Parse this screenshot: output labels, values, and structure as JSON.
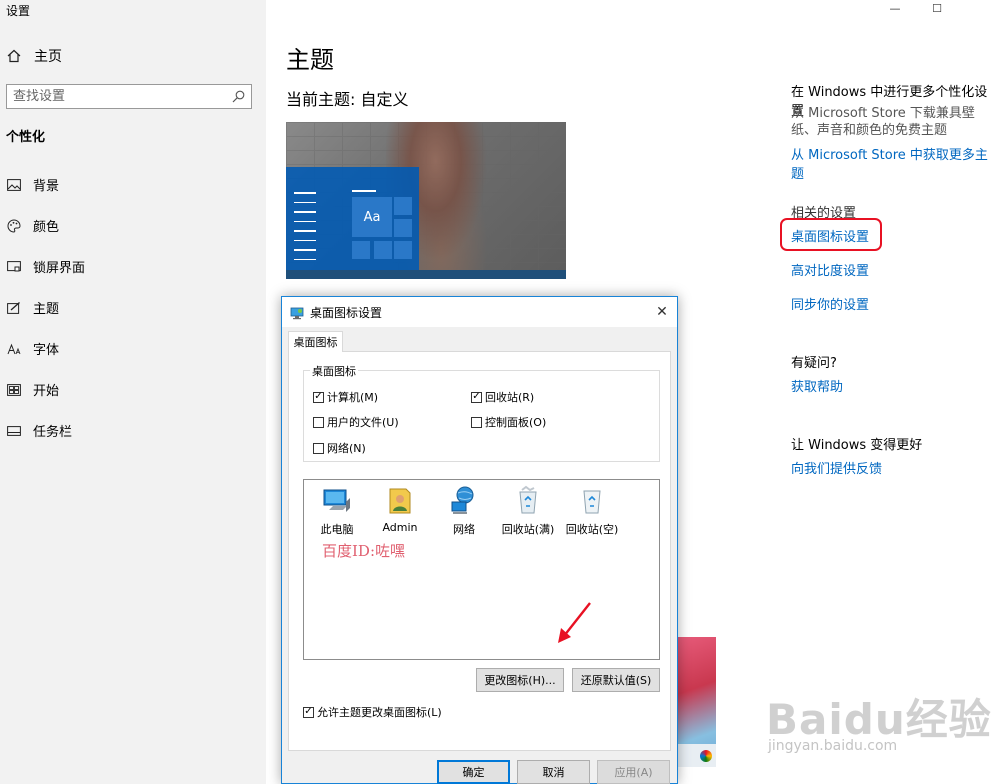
{
  "app": {
    "title": "设置"
  },
  "window_controls": {
    "minimize": "—",
    "maximize": "☐"
  },
  "sidebar": {
    "home_label": "主页",
    "search_placeholder": "查找设置",
    "section_title": "个性化",
    "items": [
      {
        "label": "背景",
        "icon": "picture-icon"
      },
      {
        "label": "颜色",
        "icon": "palette-icon"
      },
      {
        "label": "锁屏界面",
        "icon": "lock-screen-icon"
      },
      {
        "label": "主题",
        "icon": "theme-icon"
      },
      {
        "label": "字体",
        "icon": "font-icon"
      },
      {
        "label": "开始",
        "icon": "start-icon"
      },
      {
        "label": "任务栏",
        "icon": "taskbar-icon"
      }
    ]
  },
  "main": {
    "title": "主题",
    "current_theme": "当前主题: 自定义",
    "preview_sample_text": "Aa"
  },
  "right_column": {
    "more_heading": "在 Windows 中进行更多个性化设置",
    "more_desc": "从 Microsoft Store 下载兼具壁纸、声音和颜色的免费主题",
    "more_link": "从 Microsoft Store 中获取更多主题",
    "related_heading": "相关的设置",
    "related_links": [
      "桌面图标设置",
      "高对比度设置",
      "同步你的设置"
    ],
    "question_heading": "有疑问?",
    "help_link": "获取帮助",
    "better_heading": "让 Windows 变得更好",
    "feedback_link": "向我们提供反馈"
  },
  "dialog": {
    "title": "桌面图标设置",
    "close": "✕",
    "tab_label": "桌面图标",
    "group_label": "桌面图标",
    "checkboxes": [
      {
        "label": "计算机(M)",
        "checked": true
      },
      {
        "label": "回收站(R)",
        "checked": true
      },
      {
        "label": "用户的文件(U)",
        "checked": false
      },
      {
        "label": "控制面板(O)",
        "checked": false
      },
      {
        "label": "网络(N)",
        "checked": false
      }
    ],
    "icons": [
      "此电脑",
      "Admin",
      "网络",
      "回收站(满)",
      "回收站(空)"
    ],
    "watermark": "百度ID:咗嘿",
    "change_icon_button": "更改图标(H)...",
    "restore_default_button": "还原默认值(S)",
    "allow_themes_label": "允许主题更改桌面图标(L)",
    "allow_themes_checked": true,
    "ok_button": "确定",
    "cancel_button": "取消",
    "apply_button": "应用(A)"
  },
  "watermark": {
    "logo": "Baidu经验",
    "url": "jingyan.baidu.com"
  },
  "colors": {
    "accent": "#0067c0",
    "highlight": "#e81123",
    "dialog_border": "#1883d7"
  }
}
